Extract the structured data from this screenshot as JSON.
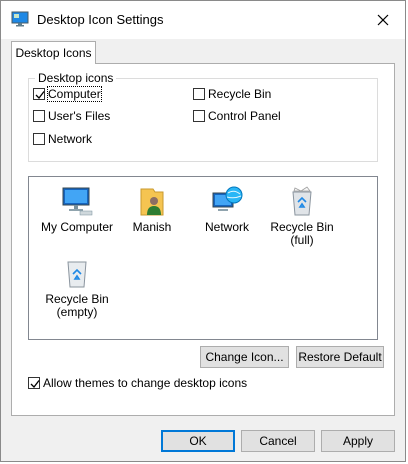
{
  "window": {
    "title": "Desktop Icon Settings"
  },
  "tab": {
    "label": "Desktop Icons"
  },
  "group": {
    "label": "Desktop icons",
    "checkboxes": [
      {
        "label": "Computer",
        "checked": true
      },
      {
        "label": "Recycle Bin",
        "checked": false
      },
      {
        "label": "User's Files",
        "checked": false
      },
      {
        "label": "Control Panel",
        "checked": false
      },
      {
        "label": "Network",
        "checked": false
      }
    ]
  },
  "icons": [
    {
      "line1": "My Computer",
      "line2": "",
      "icon": "my-computer-icon"
    },
    {
      "line1": "Manish",
      "line2": "",
      "icon": "user-folder-icon"
    },
    {
      "line1": "Network",
      "line2": "",
      "icon": "network-icon"
    },
    {
      "line1": "Recycle Bin",
      "line2": "(full)",
      "icon": "recycle-bin-full-icon"
    },
    {
      "line1": "Recycle Bin",
      "line2": "(empty)",
      "icon": "recycle-bin-empty-icon"
    }
  ],
  "buttons": {
    "change_icon": "Change Icon...",
    "restore_default": "Restore Default",
    "ok": "OK",
    "cancel": "Cancel",
    "apply": "Apply"
  },
  "themes": {
    "label": "Allow themes to change desktop icons",
    "checked": true
  },
  "colors": {
    "accent": "#0078d7",
    "window_bg": "#f0f0f0"
  }
}
